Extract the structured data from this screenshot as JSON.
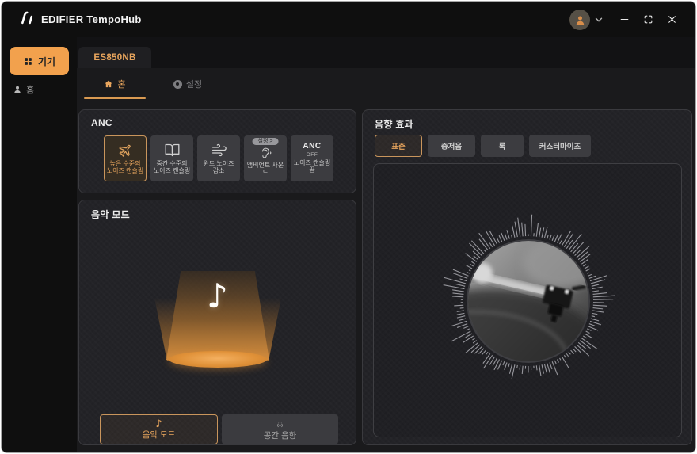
{
  "app": {
    "title": "EDIFIER TempoHub"
  },
  "colors": {
    "accent": "#F2A14D",
    "accent_text": "#E8A55D",
    "card_bg": "#232327",
    "window_bg": "#141416"
  },
  "sidebar": {
    "items": [
      {
        "label": "기기",
        "icon": "grid-icon",
        "active": true
      },
      {
        "label": "홈",
        "icon": "user-icon",
        "active": false
      }
    ]
  },
  "device_tabs": [
    {
      "label": "ES850NB",
      "active": true
    }
  ],
  "subtabs": [
    {
      "label": "홈",
      "icon": "home-icon",
      "active": true
    },
    {
      "label": "설정",
      "icon": "gear-icon",
      "active": false
    }
  ],
  "anc": {
    "title": "ANC",
    "modes": [
      {
        "label": "높은 수준의 노이즈 캔슬링",
        "icon": "airplane-icon",
        "selected": true
      },
      {
        "label": "중간 수준의 노이즈 캔슬링",
        "icon": "book-icon",
        "selected": false
      },
      {
        "label": "윈드 노이즈 감소",
        "icon": "wind-icon",
        "selected": false
      },
      {
        "label": "앰비언트 사운드",
        "icon": "ear-icon",
        "badge": "설정 >",
        "selected": false
      },
      {
        "label": "노이즈 캔슬링 끔",
        "icon": "anc-off-text",
        "icon_line1": "ANC",
        "icon_line2": "OFF",
        "selected": false
      }
    ]
  },
  "music_mode": {
    "title": "음악 모드",
    "note_glyph": "♪",
    "buttons": [
      {
        "label": "음악 모드",
        "icon": "music-note-icon",
        "selected": true
      },
      {
        "label": "공간 음향",
        "icon": "spatial-audio-icon",
        "selected": false
      }
    ]
  },
  "sound_effect": {
    "title": "음향 효과",
    "presets": [
      {
        "label": "표준",
        "selected": true
      },
      {
        "label": "중저음",
        "selected": false
      },
      {
        "label": "록",
        "selected": false
      },
      {
        "label": "커스터마이즈",
        "selected": false
      }
    ],
    "visual": "turntable-photo-with-waveform-ring"
  }
}
